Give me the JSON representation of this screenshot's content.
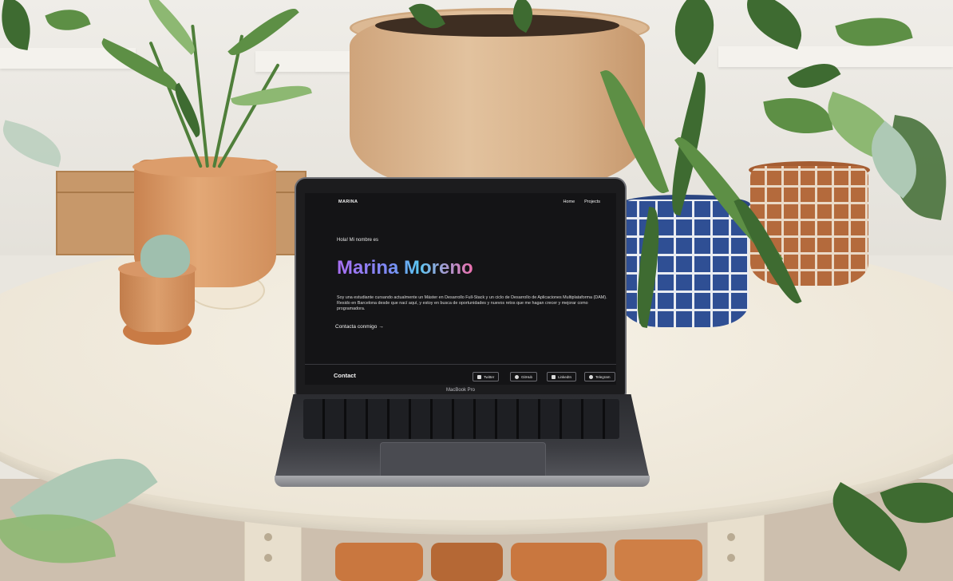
{
  "nav": {
    "brand": "MARINA",
    "links": [
      "Home",
      "Projects"
    ]
  },
  "hero": {
    "greeting": "Hola! Mi nombre es",
    "name": "Marina Moreno",
    "bio": "Soy una estudiante cursando actualmente un Máster en Desarrollo Full-Stack y un ciclo de Desarrollo de Aplicaciones Multiplataforma (DAM). Resido en Barcelona desde que nací aquí, y estoy en busca de oportunidades y nuevos retos que me hagan crecer y mejorar como programadora.",
    "cta": "Contacta conmigo →"
  },
  "footer": {
    "title": "Contact",
    "socials": [
      "Twitter",
      "GitHub",
      "LinkedIn",
      "Telegram"
    ]
  },
  "device": {
    "label": "MacBook Pro"
  },
  "colors": {
    "screen_bg": "#141416",
    "name_gradient": [
      "#a86ef2",
      "#5cc6f2",
      "#f06fae"
    ]
  }
}
